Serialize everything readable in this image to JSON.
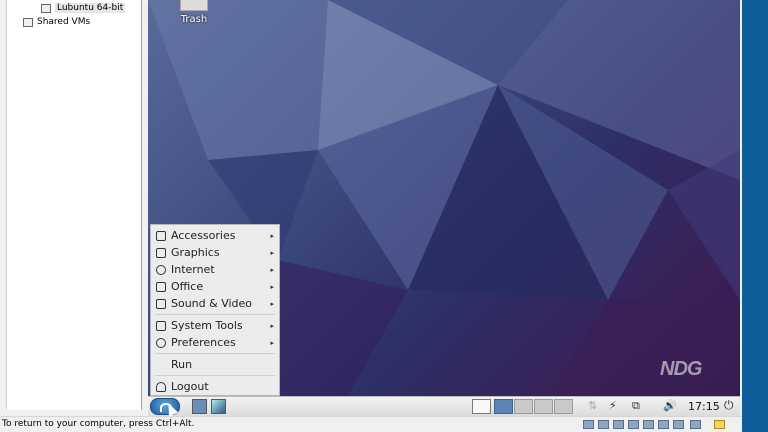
{
  "library": {
    "vm_name": "Lubuntu 64-bit",
    "shared": "Shared VMs"
  },
  "desktop": {
    "trash_label": "Trash",
    "watermark": "NDG"
  },
  "start_menu": {
    "items": [
      {
        "label": "Accessories",
        "icon": "accessories-icon"
      },
      {
        "label": "Graphics",
        "icon": "graphics-icon"
      },
      {
        "label": "Internet",
        "icon": "globe-icon"
      },
      {
        "label": "Office",
        "icon": "document-icon"
      },
      {
        "label": "Sound & Video",
        "icon": "film-icon"
      },
      {
        "label": "System Tools",
        "icon": "monitor-icon"
      },
      {
        "label": "Preferences",
        "icon": "gear-icon"
      },
      {
        "label": "Run",
        "icon": ""
      },
      {
        "label": "Logout",
        "icon": "logout-icon"
      }
    ],
    "submenu_arrow": "▸"
  },
  "taskbar": {
    "clock": "17:15",
    "power_glyph": "⚡",
    "volume_glyph": "🔊",
    "shutdown_glyph": "⏻"
  },
  "status_bar": {
    "hint": "To return to your computer, press Ctrl+Alt."
  },
  "colors": {
    "accent": "#5b85b5",
    "wallpaper_dark": "#2d2f66"
  }
}
